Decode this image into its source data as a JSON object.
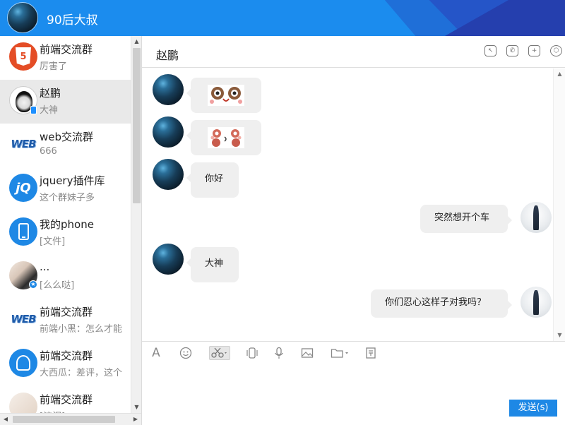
{
  "header": {
    "username": "90后大叔"
  },
  "conversations": [
    {
      "name": "前端交流群",
      "preview": "厉害了"
    },
    {
      "name": "赵鹏",
      "preview": "大神"
    },
    {
      "name": "web交流群",
      "preview": "666"
    },
    {
      "name": "jquery插件库",
      "preview": "这个群妹子多"
    },
    {
      "name": "我的phone",
      "preview": "[文件]"
    },
    {
      "name": "...",
      "preview": "[么么哒]"
    },
    {
      "name": "前端交流群",
      "preview": "前端小黑：怎么才能"
    },
    {
      "name": "前端交流群",
      "preview": "大西瓜：差评，这个"
    },
    {
      "name": "前端交流群",
      "preview": "[流泪]"
    }
  ],
  "chat": {
    "title": "赵鹏",
    "messages": [
      {
        "from": "other",
        "type": "emoji"
      },
      {
        "from": "other",
        "type": "emoji"
      },
      {
        "from": "other",
        "type": "text",
        "text": "你好"
      },
      {
        "from": "me",
        "type": "text",
        "text": "突然想开个车"
      },
      {
        "from": "other",
        "type": "text",
        "text": "大神"
      },
      {
        "from": "me",
        "type": "text",
        "text": "你们忍心这样子对我吗？"
      }
    ]
  },
  "toolbar": {
    "font_glyph": "A",
    "items": [
      "font-icon",
      "emoji-icon",
      "scissors-icon",
      "shake-icon",
      "microphone-icon",
      "image-icon",
      "folder-icon",
      "history-icon"
    ]
  },
  "composer": {
    "send_label": "发送(s)"
  },
  "colors": {
    "accent": "#1e88e5",
    "header": "#1b8cee",
    "bubble": "#efefef"
  }
}
